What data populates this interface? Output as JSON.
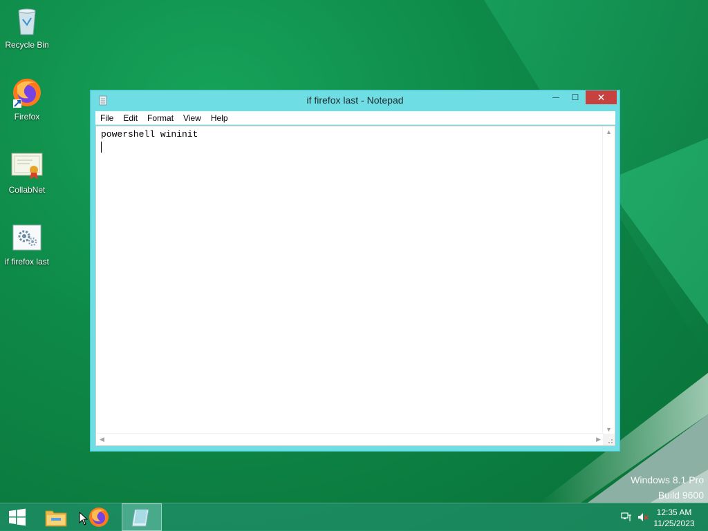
{
  "desktop": {
    "icons": [
      {
        "label": "Recycle Bin"
      },
      {
        "label": "Firefox"
      },
      {
        "label": "CollabNet"
      },
      {
        "label": "if firefox last"
      }
    ]
  },
  "window": {
    "title": "if firefox last - Notepad",
    "menu": [
      "File",
      "Edit",
      "Format",
      "View",
      "Help"
    ],
    "content": "powershell wininit",
    "buttons": {
      "minimize": "—",
      "maximize": "☐",
      "close": "✕"
    }
  },
  "watermark": {
    "line1": "Windows 8.1 Pro",
    "line2": "Build 9600"
  },
  "taskbar": {
    "items": [
      "start-icon",
      "file-explorer-icon",
      "firefox-icon",
      "notepad-icon"
    ],
    "clock": {
      "time": "12:35 AM",
      "date": "11/25/2023"
    }
  },
  "colors": {
    "window_frame": "#6fdde4",
    "close_button": "#c7413f",
    "desktop_green": "#0e8a48"
  }
}
